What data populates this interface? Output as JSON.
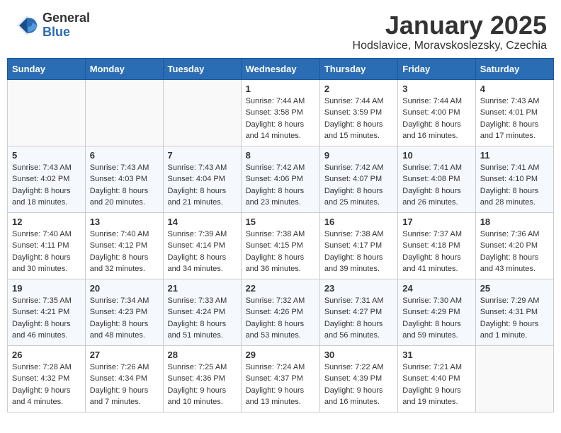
{
  "header": {
    "logo_general": "General",
    "logo_blue": "Blue",
    "month_title": "January 2025",
    "subtitle": "Hodslavice, Moravskoslezsky, Czechia"
  },
  "days_of_week": [
    "Sunday",
    "Monday",
    "Tuesday",
    "Wednesday",
    "Thursday",
    "Friday",
    "Saturday"
  ],
  "weeks": [
    [
      {
        "day": "",
        "info": ""
      },
      {
        "day": "",
        "info": ""
      },
      {
        "day": "",
        "info": ""
      },
      {
        "day": "1",
        "info": "Sunrise: 7:44 AM\nSunset: 3:58 PM\nDaylight: 8 hours\nand 14 minutes."
      },
      {
        "day": "2",
        "info": "Sunrise: 7:44 AM\nSunset: 3:59 PM\nDaylight: 8 hours\nand 15 minutes."
      },
      {
        "day": "3",
        "info": "Sunrise: 7:44 AM\nSunset: 4:00 PM\nDaylight: 8 hours\nand 16 minutes."
      },
      {
        "day": "4",
        "info": "Sunrise: 7:43 AM\nSunset: 4:01 PM\nDaylight: 8 hours\nand 17 minutes."
      }
    ],
    [
      {
        "day": "5",
        "info": "Sunrise: 7:43 AM\nSunset: 4:02 PM\nDaylight: 8 hours\nand 18 minutes."
      },
      {
        "day": "6",
        "info": "Sunrise: 7:43 AM\nSunset: 4:03 PM\nDaylight: 8 hours\nand 20 minutes."
      },
      {
        "day": "7",
        "info": "Sunrise: 7:43 AM\nSunset: 4:04 PM\nDaylight: 8 hours\nand 21 minutes."
      },
      {
        "day": "8",
        "info": "Sunrise: 7:42 AM\nSunset: 4:06 PM\nDaylight: 8 hours\nand 23 minutes."
      },
      {
        "day": "9",
        "info": "Sunrise: 7:42 AM\nSunset: 4:07 PM\nDaylight: 8 hours\nand 25 minutes."
      },
      {
        "day": "10",
        "info": "Sunrise: 7:41 AM\nSunset: 4:08 PM\nDaylight: 8 hours\nand 26 minutes."
      },
      {
        "day": "11",
        "info": "Sunrise: 7:41 AM\nSunset: 4:10 PM\nDaylight: 8 hours\nand 28 minutes."
      }
    ],
    [
      {
        "day": "12",
        "info": "Sunrise: 7:40 AM\nSunset: 4:11 PM\nDaylight: 8 hours\nand 30 minutes."
      },
      {
        "day": "13",
        "info": "Sunrise: 7:40 AM\nSunset: 4:12 PM\nDaylight: 8 hours\nand 32 minutes."
      },
      {
        "day": "14",
        "info": "Sunrise: 7:39 AM\nSunset: 4:14 PM\nDaylight: 8 hours\nand 34 minutes."
      },
      {
        "day": "15",
        "info": "Sunrise: 7:38 AM\nSunset: 4:15 PM\nDaylight: 8 hours\nand 36 minutes."
      },
      {
        "day": "16",
        "info": "Sunrise: 7:38 AM\nSunset: 4:17 PM\nDaylight: 8 hours\nand 39 minutes."
      },
      {
        "day": "17",
        "info": "Sunrise: 7:37 AM\nSunset: 4:18 PM\nDaylight: 8 hours\nand 41 minutes."
      },
      {
        "day": "18",
        "info": "Sunrise: 7:36 AM\nSunset: 4:20 PM\nDaylight: 8 hours\nand 43 minutes."
      }
    ],
    [
      {
        "day": "19",
        "info": "Sunrise: 7:35 AM\nSunset: 4:21 PM\nDaylight: 8 hours\nand 46 minutes."
      },
      {
        "day": "20",
        "info": "Sunrise: 7:34 AM\nSunset: 4:23 PM\nDaylight: 8 hours\nand 48 minutes."
      },
      {
        "day": "21",
        "info": "Sunrise: 7:33 AM\nSunset: 4:24 PM\nDaylight: 8 hours\nand 51 minutes."
      },
      {
        "day": "22",
        "info": "Sunrise: 7:32 AM\nSunset: 4:26 PM\nDaylight: 8 hours\nand 53 minutes."
      },
      {
        "day": "23",
        "info": "Sunrise: 7:31 AM\nSunset: 4:27 PM\nDaylight: 8 hours\nand 56 minutes."
      },
      {
        "day": "24",
        "info": "Sunrise: 7:30 AM\nSunset: 4:29 PM\nDaylight: 8 hours\nand 59 minutes."
      },
      {
        "day": "25",
        "info": "Sunrise: 7:29 AM\nSunset: 4:31 PM\nDaylight: 9 hours\nand 1 minute."
      }
    ],
    [
      {
        "day": "26",
        "info": "Sunrise: 7:28 AM\nSunset: 4:32 PM\nDaylight: 9 hours\nand 4 minutes."
      },
      {
        "day": "27",
        "info": "Sunrise: 7:26 AM\nSunset: 4:34 PM\nDaylight: 9 hours\nand 7 minutes."
      },
      {
        "day": "28",
        "info": "Sunrise: 7:25 AM\nSunset: 4:36 PM\nDaylight: 9 hours\nand 10 minutes."
      },
      {
        "day": "29",
        "info": "Sunrise: 7:24 AM\nSunset: 4:37 PM\nDaylight: 9 hours\nand 13 minutes."
      },
      {
        "day": "30",
        "info": "Sunrise: 7:22 AM\nSunset: 4:39 PM\nDaylight: 9 hours\nand 16 minutes."
      },
      {
        "day": "31",
        "info": "Sunrise: 7:21 AM\nSunset: 4:40 PM\nDaylight: 9 hours\nand 19 minutes."
      },
      {
        "day": "",
        "info": ""
      }
    ]
  ]
}
